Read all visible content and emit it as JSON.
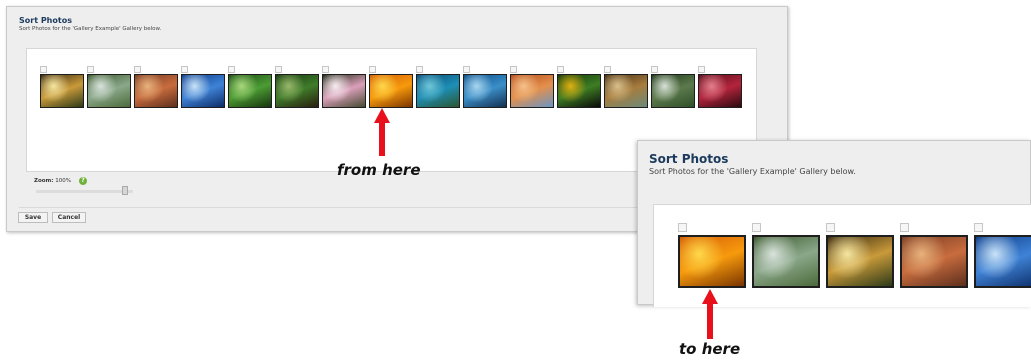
{
  "panel_main": {
    "title": "Sort Photos",
    "subtitle": "Sort Photos for the 'Gallery Example' Gallery below.",
    "photos": [
      {
        "name": "autumn-tree",
        "colors": [
          "#3a2a10",
          "#c99a3a",
          "#f6e6a0",
          "#2d3a18"
        ]
      },
      {
        "name": "mountain-stream",
        "colors": [
          "#3a5a2c",
          "#8ba88a",
          "#d9e3dc",
          "#4c6a3b"
        ]
      },
      {
        "name": "desert-butte",
        "colors": [
          "#7b3d24",
          "#c86c3e",
          "#e8b27c",
          "#5d2e1c"
        ]
      },
      {
        "name": "iceberg",
        "colors": [
          "#0f3f8c",
          "#3f83d6",
          "#c9e3f8",
          "#0d2d68"
        ]
      },
      {
        "name": "green-ferns",
        "colors": [
          "#1c4f16",
          "#4c9c34",
          "#a8d87c",
          "#17350f"
        ]
      },
      {
        "name": "forest-path",
        "colors": [
          "#163b12",
          "#3f7c2a",
          "#98b86a",
          "#2a1f0f"
        ]
      },
      {
        "name": "pink-blossoms",
        "colors": [
          "#1f2a16",
          "#dca0ba",
          "#f8eef2",
          "#444a30"
        ]
      },
      {
        "name": "orange-flowers",
        "colors": [
          "#d55e07",
          "#f79a0d",
          "#ffd84a",
          "#7a3500"
        ]
      },
      {
        "name": "sea-turtle",
        "colors": [
          "#0b4e79",
          "#1d8fb6",
          "#6fc6d8",
          "#2c5530"
        ]
      },
      {
        "name": "whale-tail",
        "colors": [
          "#0a4f89",
          "#3b8fc9",
          "#a9d6f0",
          "#132f4f"
        ]
      },
      {
        "name": "sand-dunes",
        "colors": [
          "#b64d1d",
          "#e4904c",
          "#f5c18a",
          "#6a94c4"
        ]
      },
      {
        "name": "toucan",
        "colors": [
          "#123a0c",
          "#3e7d24",
          "#e0b010",
          "#0a0a0a"
        ]
      },
      {
        "name": "savanna-trees",
        "colors": [
          "#4a3218",
          "#a77c3e",
          "#d9c08a",
          "#6b8a7a"
        ]
      },
      {
        "name": "waterfall-creek",
        "colors": [
          "#1e3a1a",
          "#5c7a4c",
          "#d8e2d6",
          "#2f4f2a"
        ]
      },
      {
        "name": "red-succulent",
        "colors": [
          "#5a0f1c",
          "#b3243c",
          "#e47f8c",
          "#2a0a10"
        ]
      }
    ],
    "zoom_label": "Zoom:",
    "zoom_value": "100%",
    "help_icon": "?",
    "save_label": "Save",
    "cancel_label": "Cancel"
  },
  "panel_zoom": {
    "title": "Sort Photos",
    "subtitle": "Sort Photos for the 'Gallery Example' Gallery below.",
    "photos": [
      {
        "name": "orange-flowers",
        "colors": [
          "#d55e07",
          "#f79a0d",
          "#ffd84a",
          "#7a3500"
        ]
      },
      {
        "name": "mountain-stream",
        "colors": [
          "#3a5a2c",
          "#8ba88a",
          "#d9e3dc",
          "#4c6a3b"
        ]
      },
      {
        "name": "autumn-tree",
        "colors": [
          "#3a2a10",
          "#c99a3a",
          "#f6e6a0",
          "#2d3a18"
        ]
      },
      {
        "name": "desert-butte",
        "colors": [
          "#7b3d24",
          "#c86c3e",
          "#e8b27c",
          "#5d2e1c"
        ]
      },
      {
        "name": "iceberg",
        "colors": [
          "#0f3f8c",
          "#3f83d6",
          "#c9e3f8",
          "#0d2d68"
        ]
      }
    ]
  },
  "annotations": {
    "from_label": "from here",
    "to_label": "to here",
    "arrow_color": "#e8111b"
  }
}
